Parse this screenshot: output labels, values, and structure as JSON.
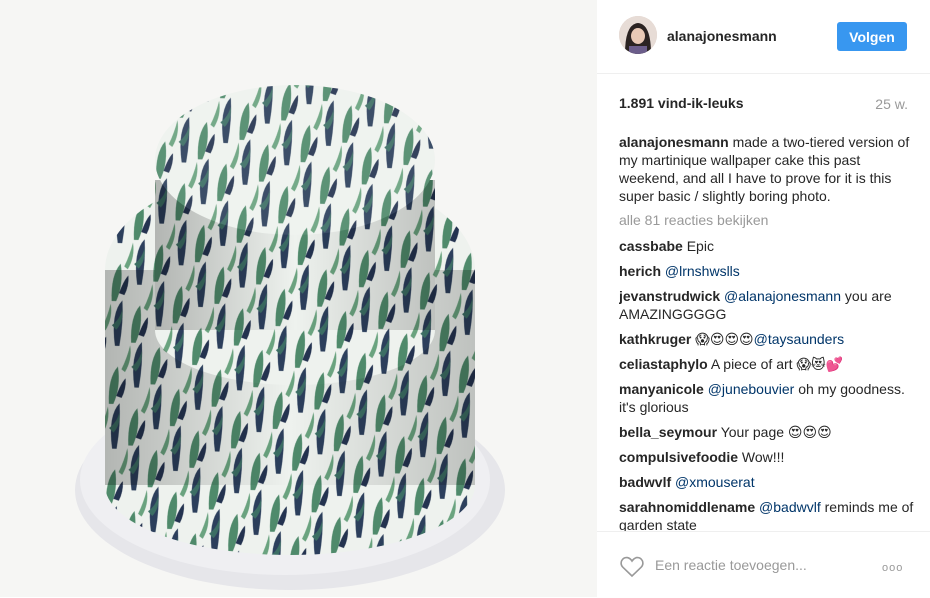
{
  "post": {
    "image_alt": "two-tiered cake with martinique wallpaper pattern"
  },
  "header": {
    "username": "alanajonesmann",
    "follow_label": "Volgen"
  },
  "stats": {
    "likes": "1.891 vind-ik-leuks",
    "age": "25 w."
  },
  "caption": {
    "user": "alanajonesmann",
    "text": "made a two-tiered version of my martinique wallpaper cake this past weekend, and all I have to prove for it is this super basic / slightly boring photo."
  },
  "view_all": "alle 81 reacties bekijken",
  "comments": [
    {
      "user": "cassbabe",
      "text": "Epic",
      "mention": ""
    },
    {
      "user": "herich",
      "text": "",
      "mention": "@lrnshwslls"
    },
    {
      "user": "jevanstrudwick",
      "mention": "@alanajonesmann",
      "text": "you are AMAZINGGGGG"
    },
    {
      "user": "kathkruger",
      "emoji": "😱😍😍😍",
      "mention": "@taysaunders",
      "text": ""
    },
    {
      "user": "celiastaphylo",
      "text": "A piece of art",
      "emoji": "😱😻💕"
    },
    {
      "user": "manyanicole",
      "mention": "@junebouvier",
      "text": "oh my goodness. it's glorious"
    },
    {
      "user": "bella_seymour",
      "text": "Your page",
      "emoji": "😍😍😍"
    },
    {
      "user": "compulsivefoodie",
      "text": "Wow!!!"
    },
    {
      "user": "badwvlf",
      "mention": "@xmouserat",
      "text": ""
    },
    {
      "user": "sarahnomiddlename",
      "mention": "@badwvlf",
      "text": "reminds me of garden state"
    }
  ],
  "footer": {
    "add_comment_placeholder": "Een reactie toevoegen...",
    "more_label": "ooo"
  },
  "colors": {
    "accent": "#3897f0",
    "mention": "#003569",
    "muted": "#999999"
  },
  "icons": {
    "like": "heart-icon",
    "more": "more-options-icon"
  }
}
